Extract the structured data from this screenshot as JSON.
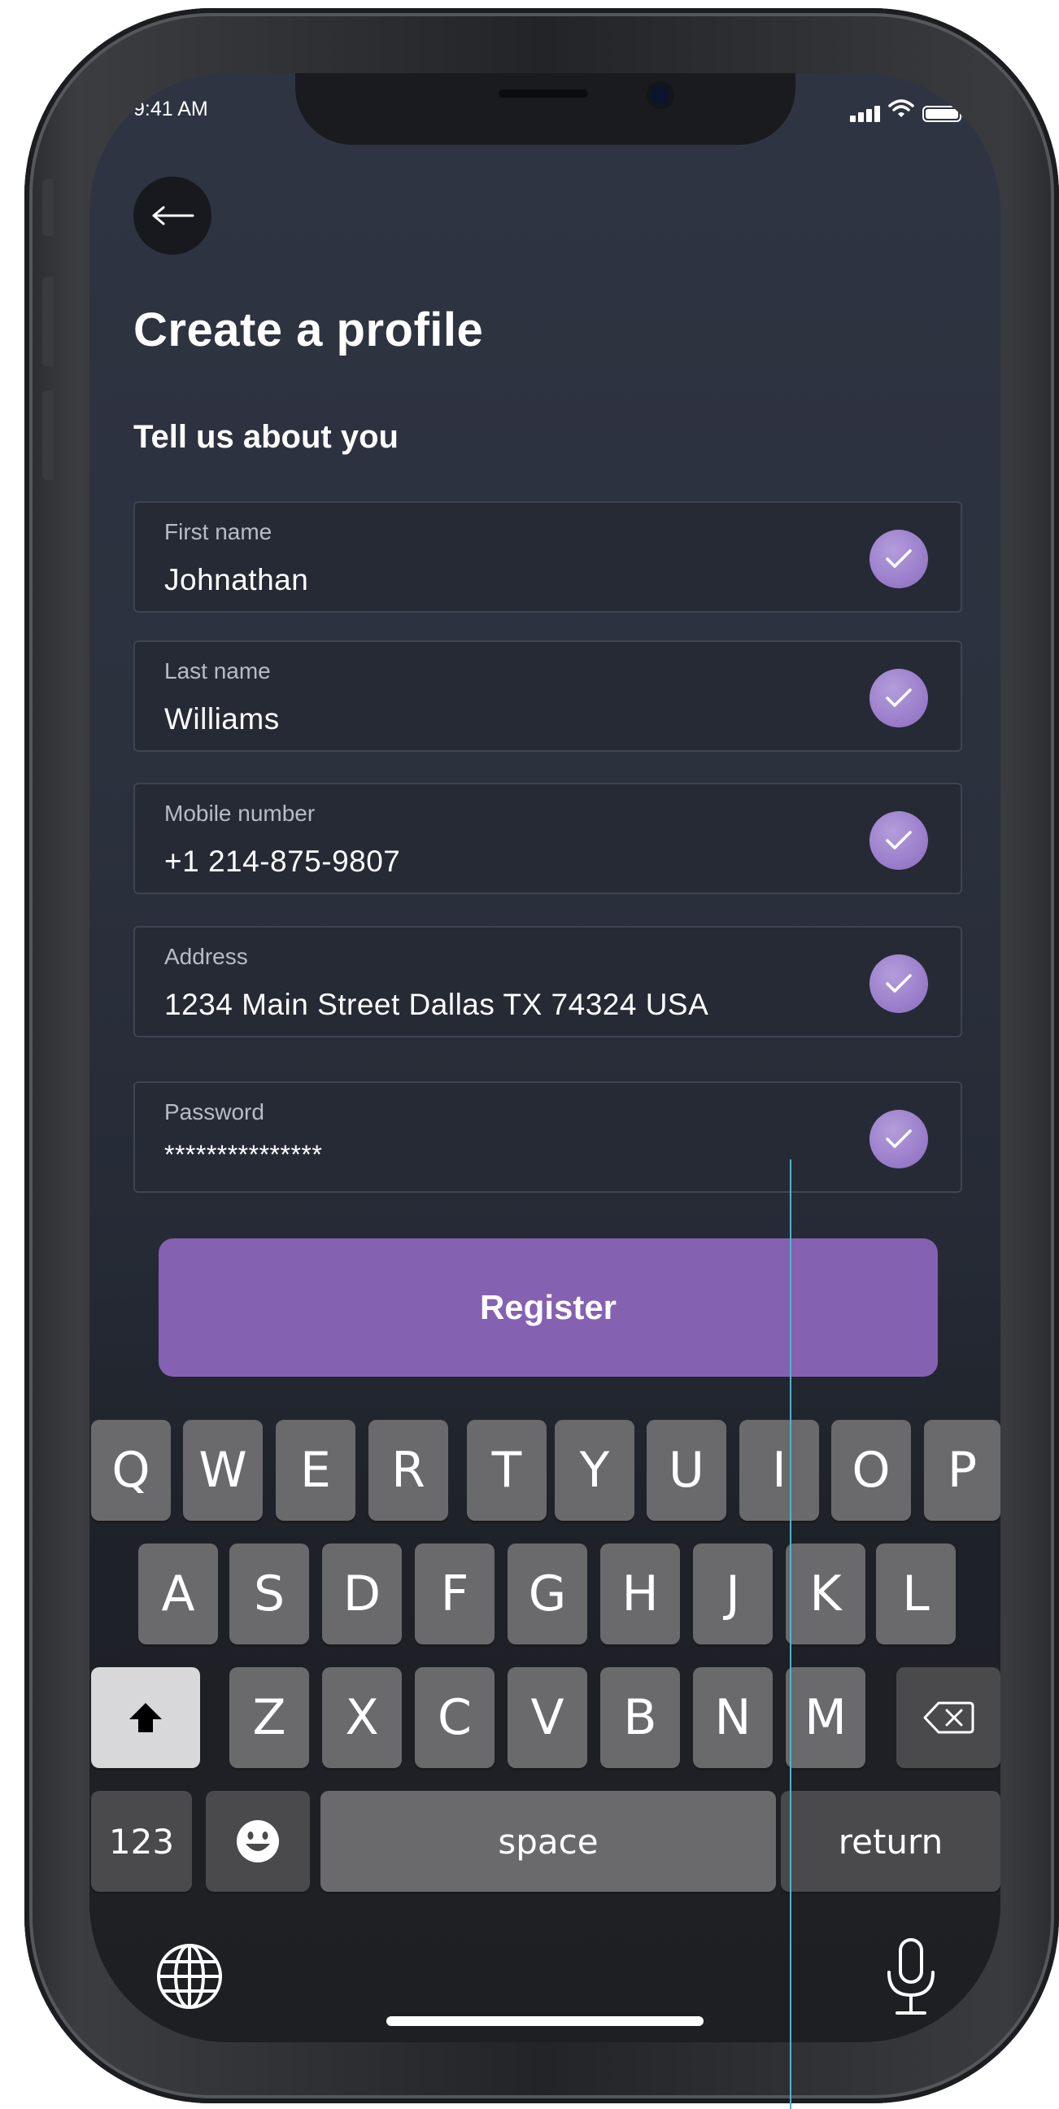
{
  "status_bar": {
    "time": "9:41 AM"
  },
  "header": {
    "title": "Create a profile",
    "subtitle": "Tell us about you"
  },
  "form": {
    "fields": [
      {
        "label": "First name",
        "value": "Johnathan",
        "valid": true
      },
      {
        "label": "Last name",
        "value": "Williams",
        "valid": true
      },
      {
        "label": "Mobile number",
        "value": "+1 214-875-9807",
        "valid": true
      },
      {
        "label": "Address",
        "value": "1234 Main Street Dallas TX 74324 USA",
        "valid": true
      },
      {
        "label": "Password",
        "value": "***************",
        "valid": true
      }
    ],
    "submit_label": "Register"
  },
  "keyboard": {
    "row1": [
      "Q",
      "W",
      "E",
      "R",
      "T",
      "Y",
      "U",
      "I",
      "O",
      "P"
    ],
    "row2": [
      "A",
      "S",
      "D",
      "F",
      "G",
      "H",
      "J",
      "K",
      "L"
    ],
    "row3": [
      "Z",
      "X",
      "C",
      "V",
      "B",
      "N",
      "M"
    ],
    "numbers_label": "123",
    "space_label": "space",
    "return_label": "return"
  },
  "colors": {
    "accent": "#8561b2",
    "check": "#9b7fcb",
    "background": "#2c313e"
  },
  "icons": [
    "back-arrow-icon",
    "signal-icon",
    "wifi-icon",
    "battery-icon",
    "check-icon",
    "shift-icon",
    "delete-icon",
    "emoji-icon",
    "globe-icon",
    "microphone-icon"
  ]
}
